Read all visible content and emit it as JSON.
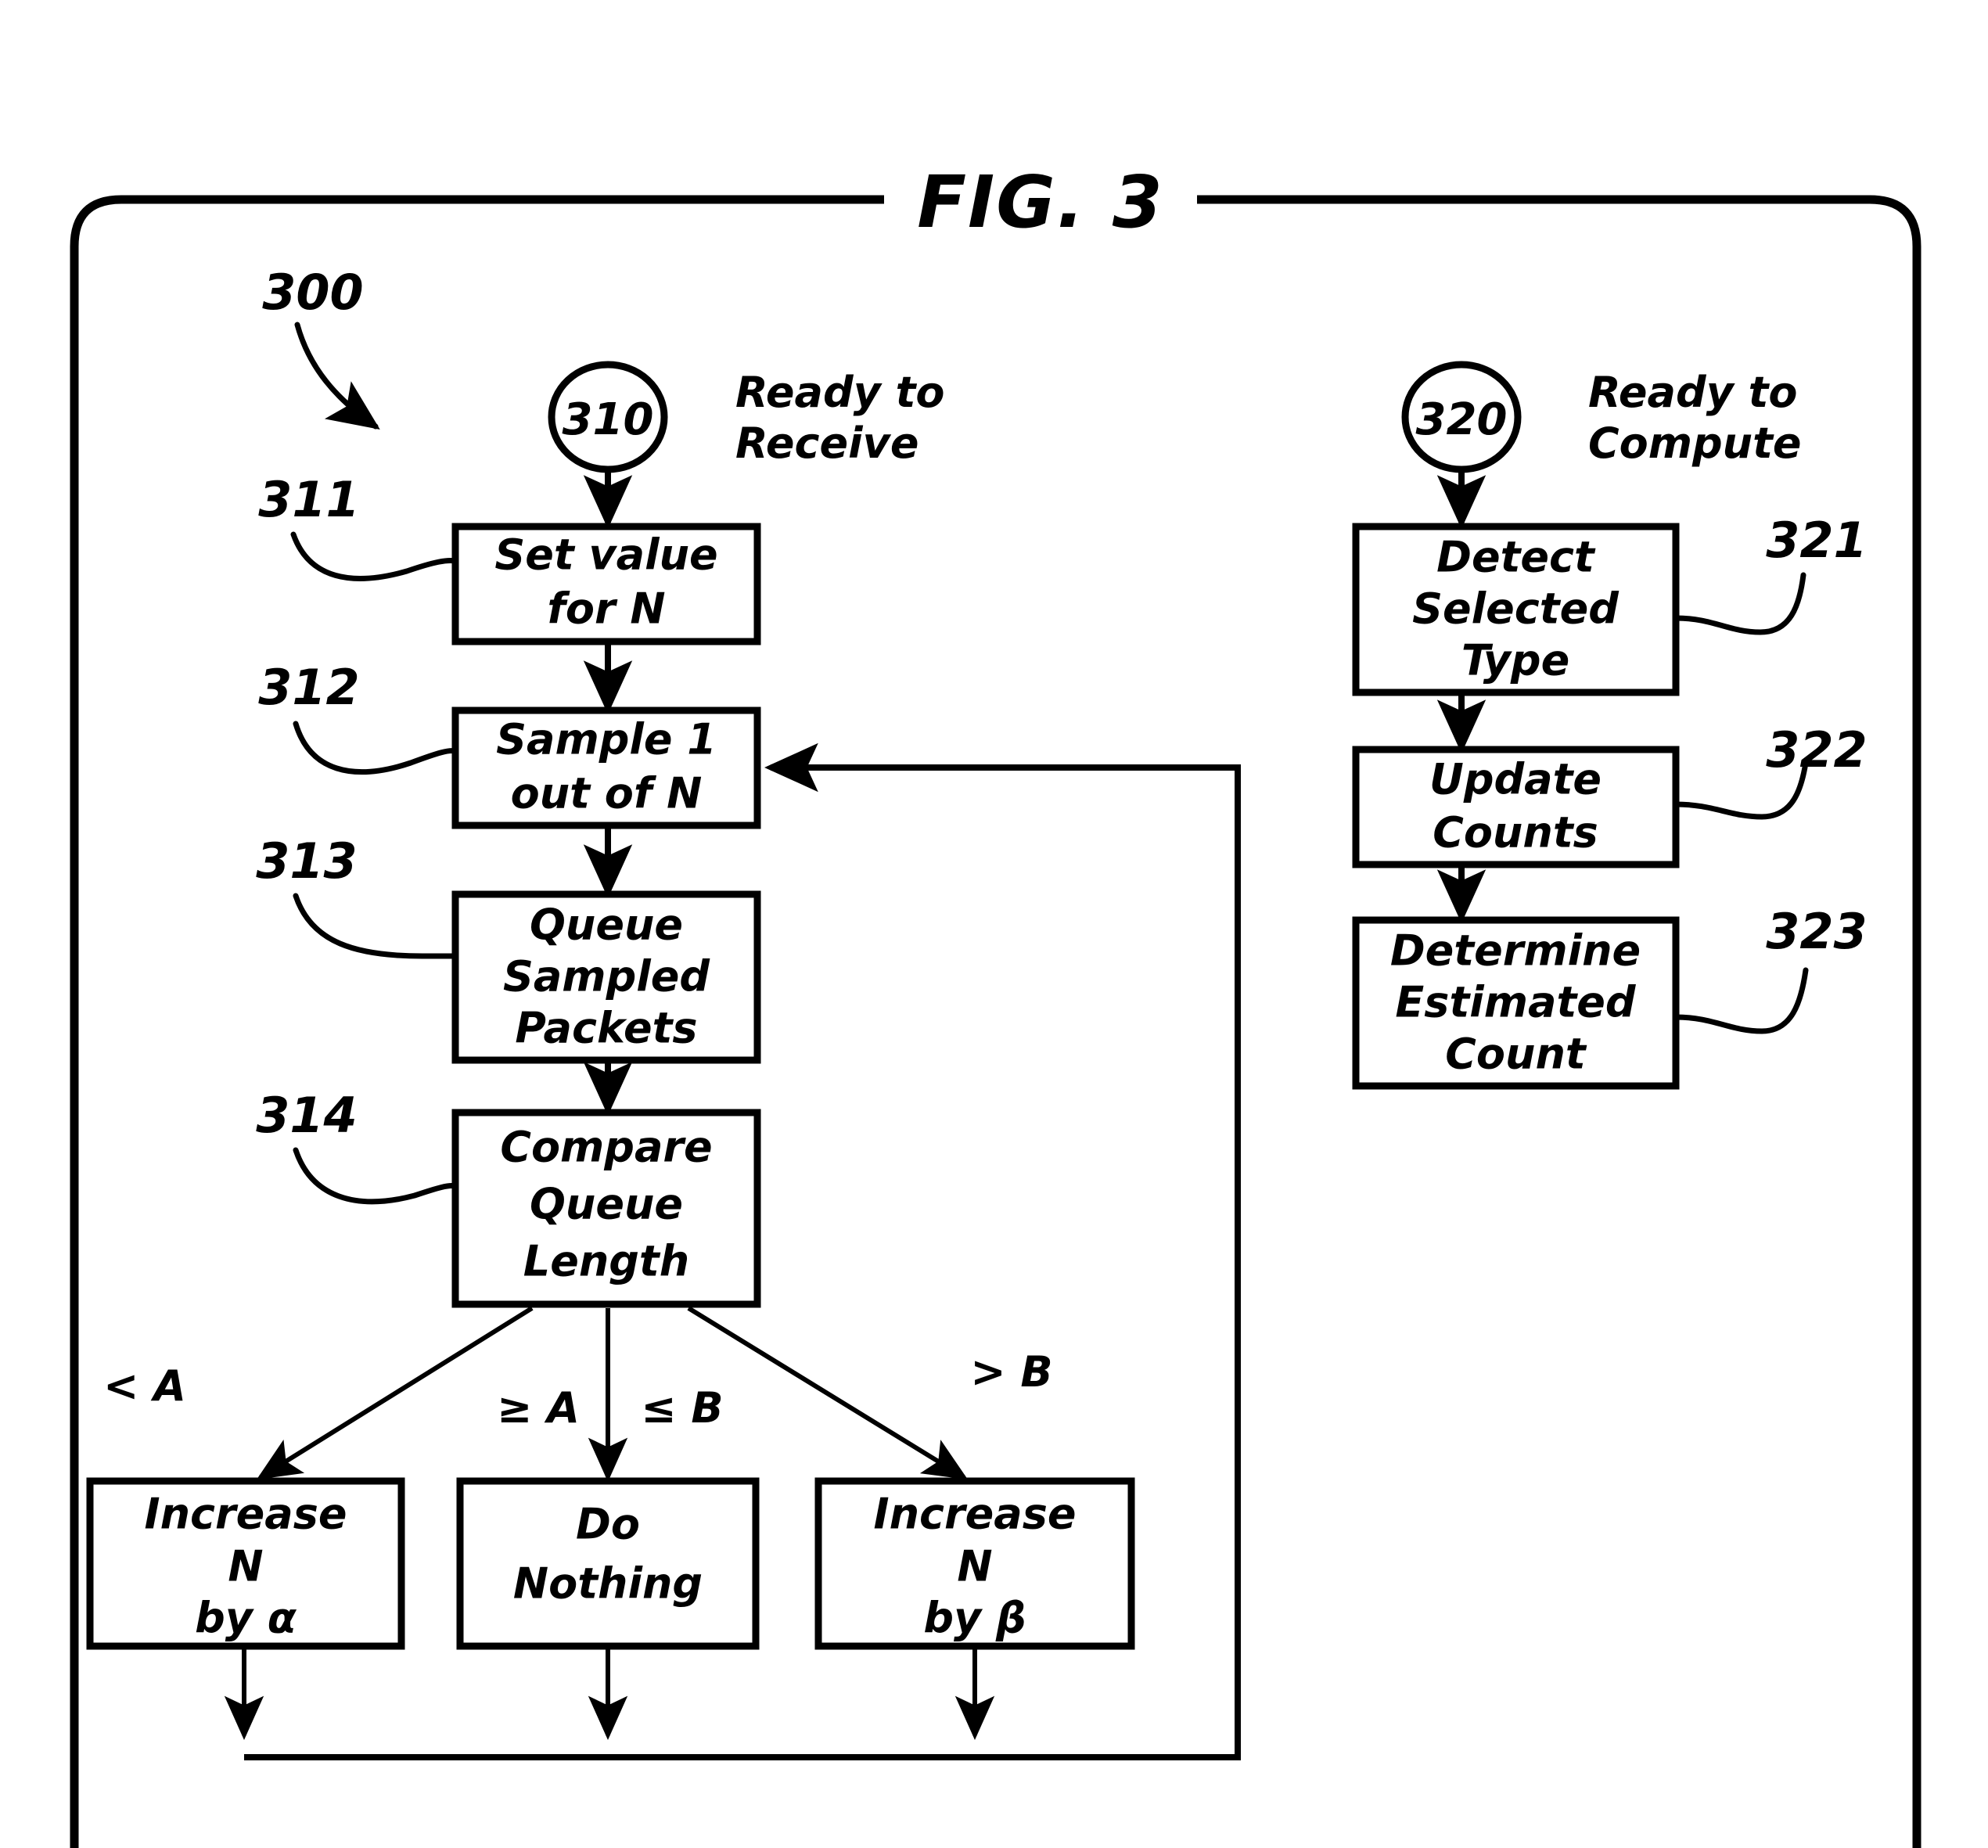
{
  "figure": {
    "title": "FIG. 3",
    "diagram_ref": "300"
  },
  "left_flow": {
    "start_node": {
      "id": "310",
      "state_label_line1": "Ready to",
      "state_label_line2": "Receive"
    },
    "steps": [
      {
        "ref": "311",
        "lines": [
          "Set  value",
          "for  N"
        ]
      },
      {
        "ref": "312",
        "lines": [
          "Sample 1",
          "out  of  N"
        ]
      },
      {
        "ref": "313",
        "lines": [
          "Queue",
          "Sampled",
          "Packets"
        ]
      },
      {
        "ref": "314",
        "lines": [
          "Compare",
          "Queue",
          "Length"
        ]
      }
    ],
    "branch_conditions": [
      {
        "label": "< A"
      },
      {
        "label": "≥ A"
      },
      {
        "label": "≤ B"
      },
      {
        "label": "> B"
      }
    ],
    "outcomes": [
      {
        "lines": [
          "Increase",
          "N",
          "by  α"
        ]
      },
      {
        "lines": [
          "Do",
          "Nothing"
        ]
      },
      {
        "lines": [
          "Increase",
          "N",
          "by  β"
        ]
      }
    ]
  },
  "right_flow": {
    "start_node": {
      "id": "320",
      "state_label_line1": "Ready to",
      "state_label_line2": "Compute"
    },
    "steps": [
      {
        "ref": "321",
        "lines": [
          "Detect",
          "Selected",
          "Type"
        ]
      },
      {
        "ref": "322",
        "lines": [
          "Update",
          "Counts"
        ]
      },
      {
        "ref": "323",
        "lines": [
          "Determine",
          "Estimated",
          "Count"
        ]
      }
    ]
  },
  "colors": {
    "ink": "#000000",
    "paper": "#ffffff"
  }
}
